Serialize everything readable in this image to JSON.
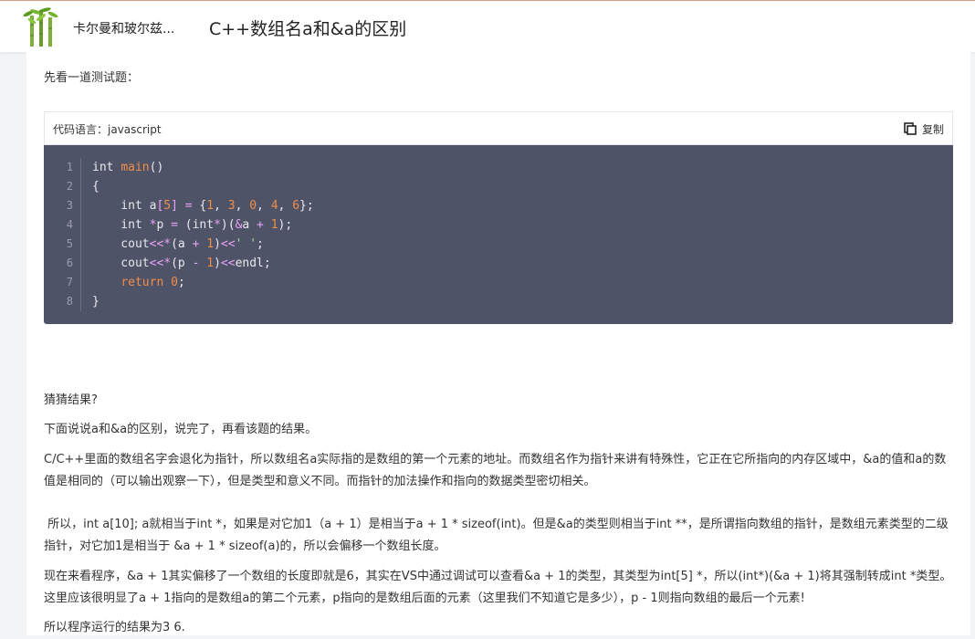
{
  "header": {
    "author": "卡尔曼和玻尔兹...",
    "title": "C++数组名a和&a的区别"
  },
  "content": {
    "intro": "先看一道测试题：",
    "code_block": {
      "language_label": "代码语言：javascript",
      "copy_label": "复制",
      "line_numbers": [
        "1",
        "2",
        "3",
        "4",
        "5",
        "6",
        "7",
        "8"
      ],
      "lines": [
        "int main()",
        "{",
        "    int a[5] = {1, 3, 0, 4, 6};",
        "    int *p = (int*)(&a + 1);",
        "    cout<<*(a + 1)<<' ';",
        "    cout<<*(p - 1)<<endl;",
        "    return 0;",
        "}"
      ]
    },
    "paragraphs": [
      "猜猜结果?",
      "下面说说a和&a的区别，说完了，再看该题的结果。",
      "C/C++里面的数组名字会退化为指针，所以数组名a实际指的是数组的第一个元素的地址。而数组名作为指针来讲有特殊性，它正在它所指向的内存区域中，&a的值和a的数值是相同的（可以输出观察一下），但是类型和意义不同。而指针的加法操作和指向的数据类型密切相关。",
      " 所以，int a[10]; a就相当于int *，如果是对它加1（a + 1）是相当于a + 1 * sizeof(int)。但是&a的类型则相当于int **，是所谓指向数组的指针，是数组元素类型的二级指针，对它加1是相当于 &a + 1 * sizeof(a)的，所以会偏移一个数组长度。",
      "现在来看程序，&a + 1其实偏移了一个数组的长度即就是6，其实在VS中通过调试可以查看&a + 1的类型，其类型为int[5] *，所以(int*)(&a + 1)将其强制转成int *类型。这里应该很明显了a + 1指向的是数组a的第二个元素，p指向的是数组后面的元素（这里我们不知道它是多少），p - 1则指向数组的最后一个元素!",
      "所以程序运行的结果为3 6."
    ]
  },
  "colors": {
    "code_background": "#4f5367",
    "keyword_accent": "#f08d49",
    "operator": "#e9a3f5"
  }
}
